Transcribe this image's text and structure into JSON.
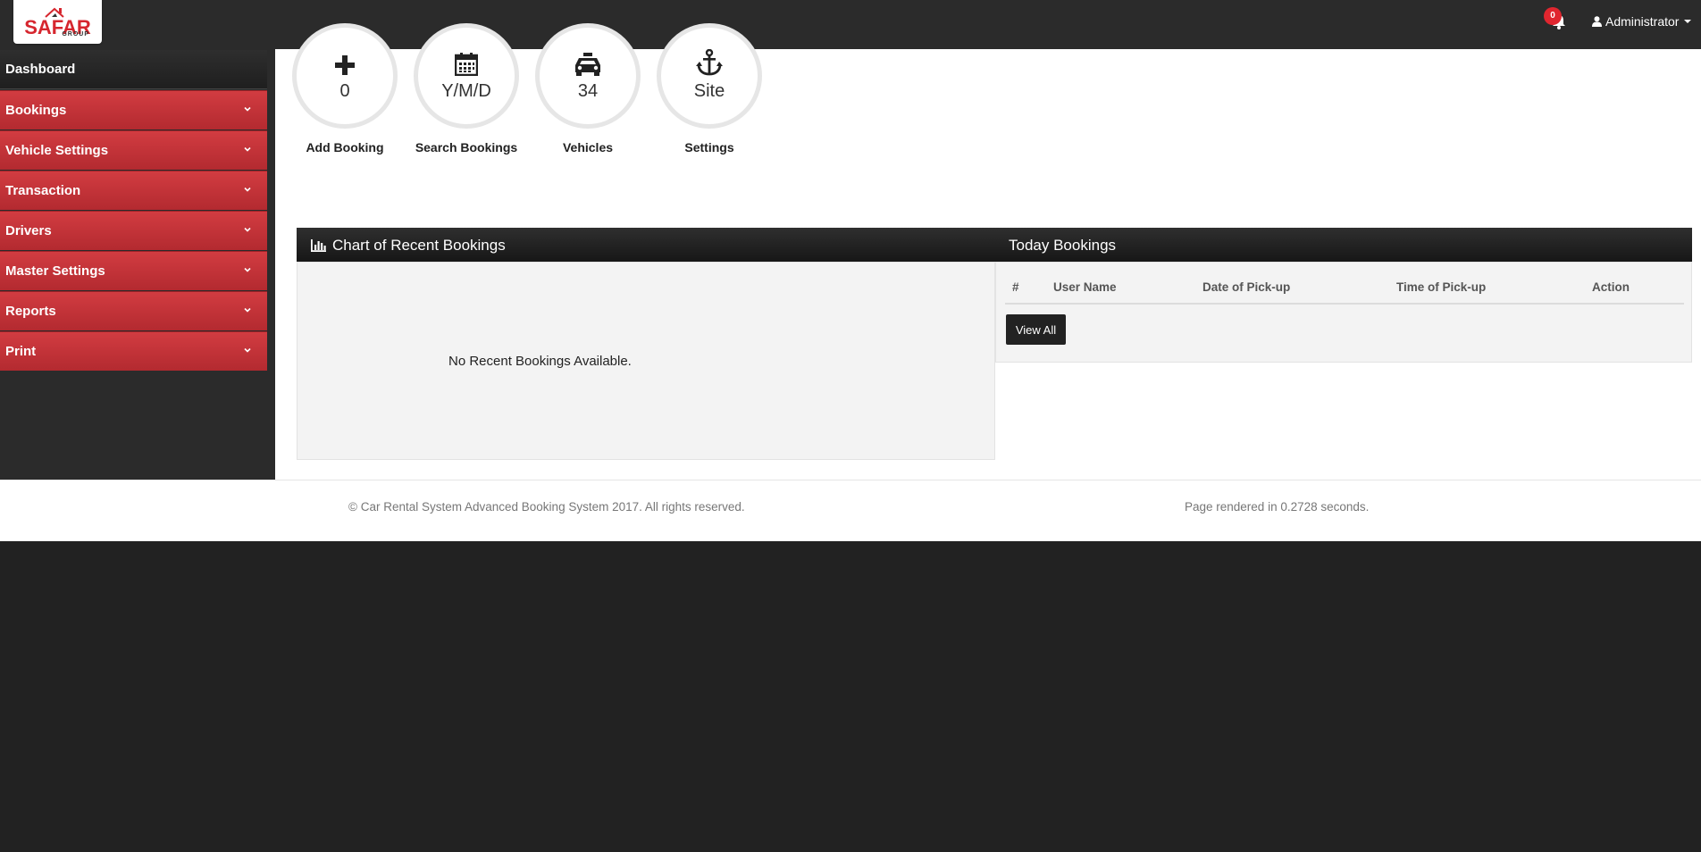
{
  "header": {
    "logo": {
      "name": "SAFAR",
      "sub": "GROUP"
    },
    "notifications": {
      "count": "0"
    },
    "user": {
      "label": "Administrator"
    }
  },
  "sidebar": {
    "items": [
      {
        "label": "Dashboard",
        "icon": "chevron-down-icon"
      },
      {
        "label": "Bookings",
        "icon": "chevron-down-icon"
      },
      {
        "label": "Vehicle Settings",
        "icon": "chevron-down-icon"
      },
      {
        "label": "Transaction",
        "icon": "chevron-down-icon"
      },
      {
        "label": "Drivers",
        "icon": "chevron-down-icon"
      },
      {
        "label": "Master Settings",
        "icon": "chevron-down-icon"
      },
      {
        "label": "Reports",
        "icon": "chevron-down-icon"
      },
      {
        "label": "Print",
        "icon": "chevron-down-icon"
      }
    ]
  },
  "tiles": [
    {
      "icon": "plus-icon",
      "value": "0",
      "label": "Add Booking"
    },
    {
      "icon": "calendar-icon",
      "value": "Y/M/D",
      "label": "Search Bookings"
    },
    {
      "icon": "taxi-icon",
      "value": "34",
      "label": "Vehicles"
    },
    {
      "icon": "anchor-icon",
      "value": "Site",
      "label": "Settings"
    }
  ],
  "chart_panel": {
    "title": "Chart of Recent Bookings",
    "empty_text": "No Recent Bookings Available."
  },
  "today_panel": {
    "title": "Today Bookings",
    "columns": [
      "#",
      "User Name",
      "Date of Pick-up",
      "Time of Pick-up",
      "Action"
    ],
    "view_all_label": "View All"
  },
  "footer": {
    "copyright": "© Car Rental System Advanced Booking System 2017. All rights reserved.",
    "render_time": "Page rendered in 0.2728 seconds."
  },
  "colors": {
    "accent_red": "#c9353b",
    "dark": "#2b2b2b"
  }
}
